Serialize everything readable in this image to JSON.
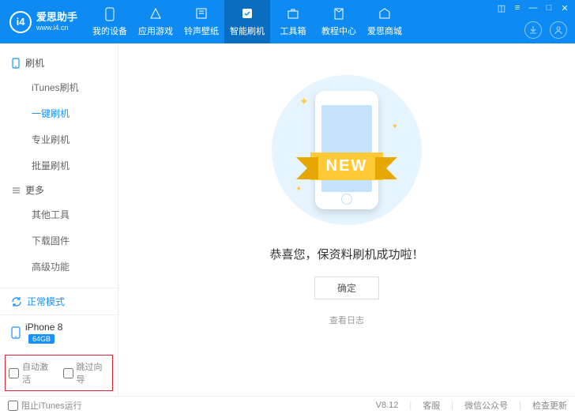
{
  "app": {
    "name": "爱思助手",
    "url": "www.i4.cn",
    "logo_letters": "i4"
  },
  "nav": [
    {
      "label": "我的设备"
    },
    {
      "label": "应用游戏"
    },
    {
      "label": "铃声壁纸"
    },
    {
      "label": "智能刷机",
      "active": true
    },
    {
      "label": "工具箱"
    },
    {
      "label": "教程中心"
    },
    {
      "label": "爱思商城"
    }
  ],
  "sidebar": {
    "groups": [
      {
        "title": "刷机",
        "items": [
          "iTunes刷机",
          "一键刷机",
          "专业刷机",
          "批量刷机"
        ],
        "active_index": 1
      },
      {
        "title": "更多",
        "items": [
          "其他工具",
          "下载固件",
          "高级功能"
        ],
        "active_index": -1
      }
    ],
    "status": "正常模式",
    "device": {
      "name": "iPhone 8",
      "storage": "64GB"
    },
    "checks": [
      "自动激活",
      "跳过向导"
    ]
  },
  "main": {
    "ribbon": "NEW",
    "success_msg": "恭喜您，保资料刷机成功啦！",
    "ok": "确定",
    "view_log": "查看日志"
  },
  "footer": {
    "block_itunes": "阻止iTunes运行",
    "version": "V8.12",
    "links": [
      "客服",
      "微信公众号",
      "检查更新"
    ]
  }
}
